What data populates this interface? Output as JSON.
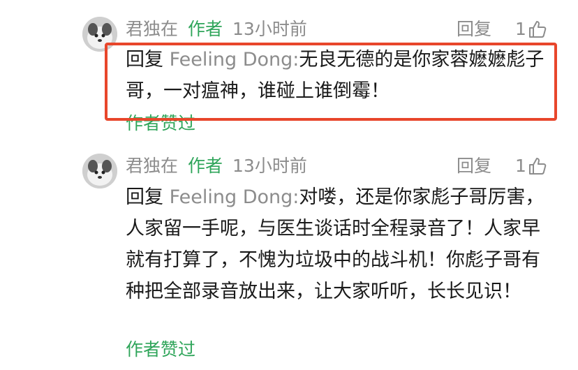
{
  "comments": [
    {
      "user": "君独在",
      "author_tag": "作者",
      "time": "13小时前",
      "reply_label": "回复",
      "likes": "1",
      "reply_prefix": "回复",
      "reply_target": "Feeling Dong:",
      "text": "无良无德的是你家蓉嬷嬷彪子哥，一对瘟神，谁碰上谁倒霉！",
      "liked_label": "作者赞过",
      "highlighted": true
    },
    {
      "user": "君独在",
      "author_tag": "作者",
      "time": "13小时前",
      "reply_label": "回复",
      "likes": "1",
      "reply_prefix": "回复",
      "reply_target": "Feeling Dong:",
      "text": "对喽，还是你家彪子哥厉害，人家留一手呢，与医生谈话时全程录音了！人家早就有打算了，不愧为垃圾中的战斗机！你彪子哥有种把全部录音放出来，让大家听听，长长见识！",
      "liked_label": "作者赞过",
      "highlighted": false
    }
  ],
  "colors": {
    "author_green": "#2fa55a",
    "meta_gray": "#8c8c8c",
    "highlight_red": "#e8462b"
  },
  "icons": [
    "avatar",
    "thumbs-up-icon"
  ]
}
